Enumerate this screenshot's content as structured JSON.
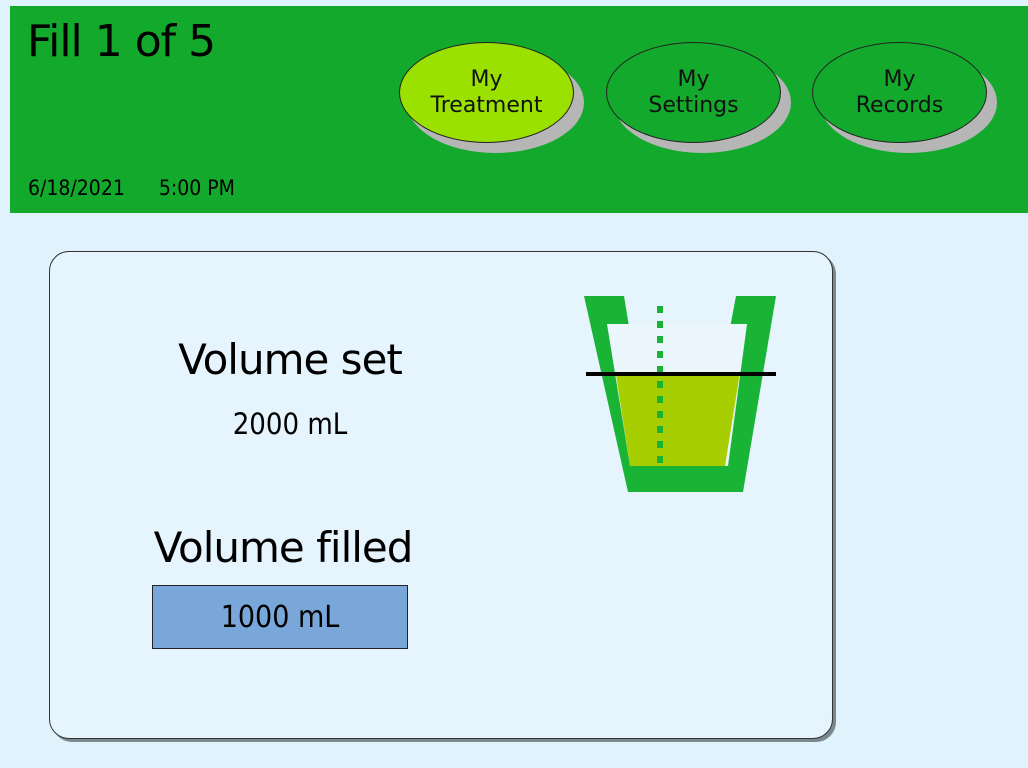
{
  "header": {
    "fill_status": "Fill 1 of 5",
    "date": "6/18/2021",
    "time": "5:00 PM",
    "nav": [
      {
        "line1": "My",
        "line2": "Treatment",
        "active": true
      },
      {
        "line1": "My",
        "line2": "Settings",
        "active": false
      },
      {
        "line1": "My",
        "line2": "Records",
        "active": false
      }
    ]
  },
  "main": {
    "volume_set_label": "Volume set",
    "volume_set_value": "2000 mL",
    "volume_filled_label": "Volume filled",
    "volume_filled_value": "1000 mL",
    "fill_fraction": 0.5
  },
  "colors": {
    "header": "#13a92c",
    "active_button": "#9be100",
    "background": "#e0f2fc",
    "fluid": "#a6ce00",
    "filled_box": "#7aa7da"
  },
  "icons": [
    "graduated-cup-icon"
  ]
}
